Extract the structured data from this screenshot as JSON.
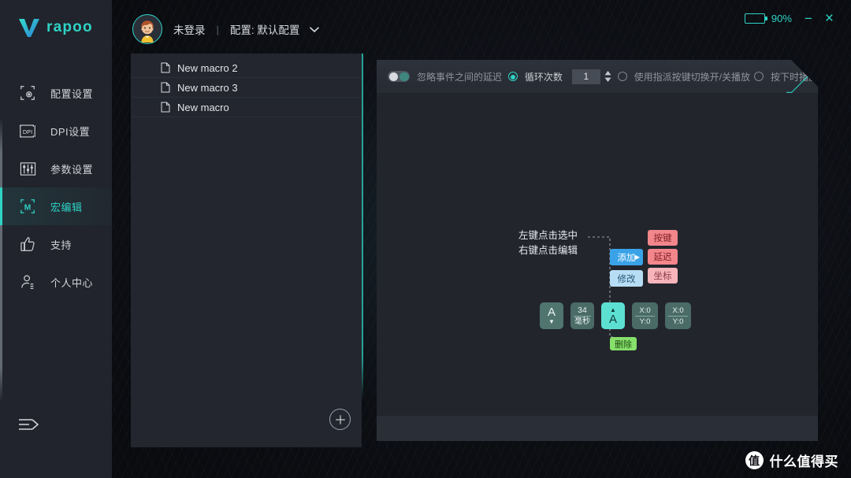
{
  "brand": {
    "name": "rapoo",
    "logo_icon": "rapoo-v-logo-icon"
  },
  "titlebar": {
    "battery_icon": "battery-icon",
    "battery_percent": "90%",
    "minimize_label": "−",
    "close_label": "×"
  },
  "header": {
    "avatar_icon": "user-avatar-icon",
    "login_state": "未登录",
    "separator": "|",
    "profile_label": "配置: 默认配置",
    "chevron_icon": "chevron-down-icon"
  },
  "sidebar": {
    "items": [
      {
        "label": "配置设置",
        "icon": "config-settings-icon",
        "active": false
      },
      {
        "label": "DPI设置",
        "icon": "dpi-settings-icon",
        "active": false
      },
      {
        "label": "参数设置",
        "icon": "parameter-settings-icon",
        "active": false
      },
      {
        "label": "宏编辑",
        "icon": "macro-edit-icon",
        "active": true
      },
      {
        "label": "支持",
        "icon": "thumbs-up-icon",
        "active": false
      },
      {
        "label": "个人中心",
        "icon": "user-profile-icon",
        "active": false
      }
    ],
    "collapse_icon": "collapse-panel-icon"
  },
  "macro_list": {
    "items": [
      {
        "label": "New macro 2",
        "icon": "document-icon"
      },
      {
        "label": "New macro 3",
        "icon": "document-icon"
      },
      {
        "label": "New macro",
        "icon": "document-icon"
      }
    ],
    "add_button_icon": "plus-circle-icon"
  },
  "toolbar": {
    "ignore_delay_label": "忽略事件之间的延迟",
    "ignore_delay_on": false,
    "loop_count_label": "循环次数",
    "loop_count_value": "1",
    "loop_count_selected": true,
    "toggle_play_label": "使用指派按键切换开/关播放",
    "toggle_play_selected": false,
    "hold_play_label": "按下时播放",
    "hold_play_selected": false,
    "spinner_icon": "spinner-updown-icon"
  },
  "canvas": {
    "hint_line1": "左键点击选中",
    "hint_line2": "右键点击编辑",
    "context_menu": [
      {
        "label": "添加",
        "style": "primary",
        "has_submenu": true
      },
      {
        "label": "修改",
        "style": "secondary",
        "has_submenu": false
      }
    ],
    "submenu": [
      {
        "label": "按键",
        "style": "red"
      },
      {
        "label": "延迟",
        "style": "red"
      },
      {
        "label": "坐标",
        "style": "pink"
      }
    ],
    "sequence": [
      {
        "type": "key",
        "letter": "A",
        "arrow": "▼",
        "arrow_pos": "bottom",
        "active": false
      },
      {
        "type": "delay",
        "value": "34",
        "unit": "毫秒"
      },
      {
        "type": "key",
        "letter": "A",
        "arrow": "▲",
        "arrow_pos": "top",
        "active": true
      },
      {
        "type": "coord",
        "x": "X:0",
        "y": "Y:0"
      },
      {
        "type": "coord",
        "x": "X:0",
        "y": "Y:0"
      }
    ],
    "delete_label": "删除"
  },
  "watermark": {
    "badge": "值",
    "text": "什么值得买"
  },
  "colors": {
    "accent": "#2ed3c6",
    "sidebar_bg": "#21242c",
    "panel_bg": "#23262e",
    "menu_primary": "#3aa3e8",
    "menu_secondary": "#b7ddf5",
    "submenu_red": "#f2868b",
    "submenu_pink": "#f7b4bb",
    "tile_active": "#5ce0d2",
    "delete_green": "#86e06a"
  }
}
